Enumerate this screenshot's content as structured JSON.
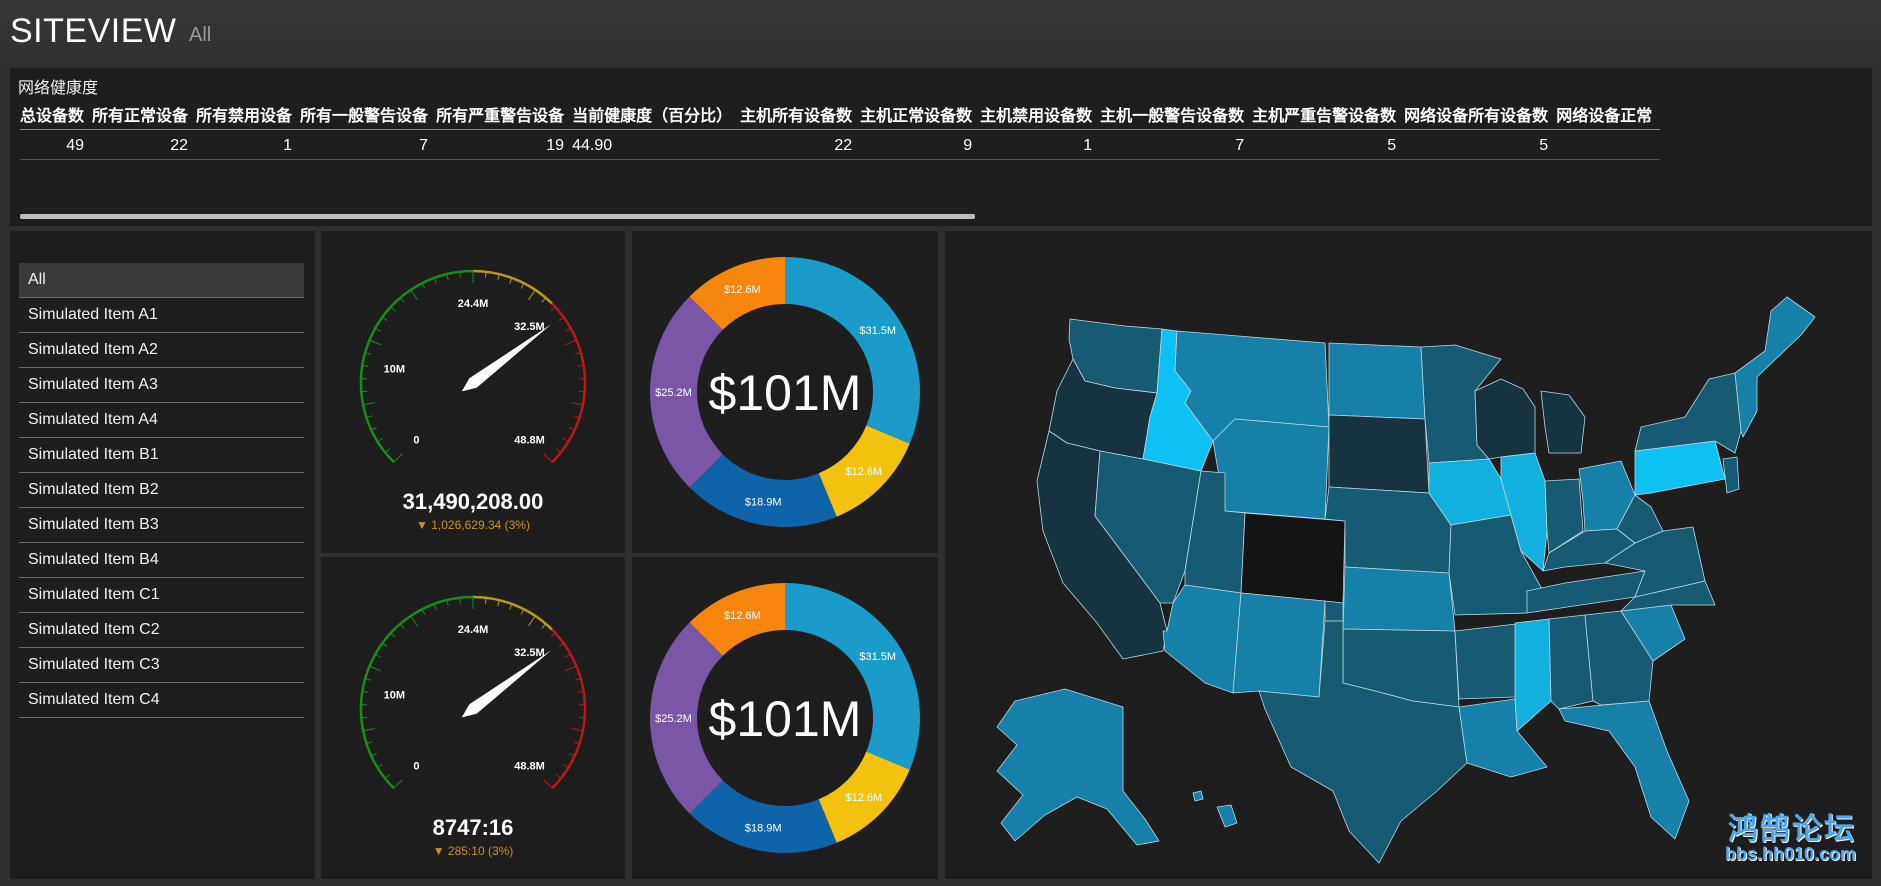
{
  "header": {
    "title": "SITEVIEW",
    "subtitle": "All"
  },
  "health": {
    "title": "网络健康度",
    "columns": [
      "总设备数",
      "所有正常设备",
      "所有禁用设备",
      "所有一般警告设备",
      "所有严重警告设备",
      "当前健康度（百分比）",
      "主机所有设备数",
      "主机正常设备数",
      "主机禁用设备数",
      "主机一般警告设备数",
      "主机严重告警设备数",
      "网络设备所有设备数",
      "网络设备正常"
    ],
    "row": [
      "49",
      "22",
      "1",
      "7",
      "19",
      "44.90",
      "22",
      "9",
      "1",
      "7",
      "5",
      "5",
      ""
    ]
  },
  "list": {
    "items": [
      "All",
      "Simulated Item A1",
      "Simulated Item A2",
      "Simulated Item A3",
      "Simulated Item A4",
      "Simulated Item B1",
      "Simulated Item B2",
      "Simulated Item B3",
      "Simulated Item B4",
      "Simulated Item C1",
      "Simulated Item C2",
      "Simulated Item C3",
      "Simulated Item C4"
    ],
    "selected": "All"
  },
  "gauges": [
    {
      "value_text": "31,490,208.00",
      "delta_text": "▼ 1,026,629.34 (3%)",
      "tick_labels": [
        "0",
        "10M",
        "24.4M",
        "32.5M",
        "48.8M"
      ],
      "needle_value": 34,
      "max": 48.8
    },
    {
      "value_text": "8747:16",
      "delta_text": "▼ 285:10 (3%)",
      "tick_labels": [
        "0",
        "10M",
        "24.4M",
        "32.5M",
        "48.8M"
      ],
      "needle_value": 34,
      "max": 48.8
    }
  ],
  "donuts": [
    {
      "center_text": "$101M",
      "slices": [
        {
          "label": "$31.5M",
          "value": 31.5,
          "color": "#1a9bc9"
        },
        {
          "label": "$12.6M",
          "value": 12.6,
          "color": "#f2c20f"
        },
        {
          "label": "$18.9M",
          "value": 18.9,
          "color": "#0f63a8"
        },
        {
          "label": "$25.2M",
          "value": 25.2,
          "color": "#7a56a6"
        },
        {
          "label": "$12.6M",
          "value": 12.6,
          "color": "#f7860f"
        }
      ]
    },
    {
      "center_text": "$101M",
      "slices": [
        {
          "label": "$31.5M",
          "value": 31.5,
          "color": "#1a9bc9"
        },
        {
          "label": "$12.6M",
          "value": 12.6,
          "color": "#f2c20f"
        },
        {
          "label": "$18.9M",
          "value": 18.9,
          "color": "#0f63a8"
        },
        {
          "label": "$25.2M",
          "value": 25.2,
          "color": "#7a56a6"
        },
        {
          "label": "$12.6M",
          "value": 12.6,
          "color": "#f7860f"
        }
      ]
    }
  ],
  "map": {
    "colors": {
      "dark": "#16333f",
      "mid_dark": "#175b73",
      "mid": "#1680a8",
      "bright": "#12b0de",
      "brightest": "#0fc0f2",
      "none": "#141414"
    }
  },
  "watermark": {
    "line1": "鸿鹄论坛",
    "line2": "bbs.hh010.com"
  }
}
